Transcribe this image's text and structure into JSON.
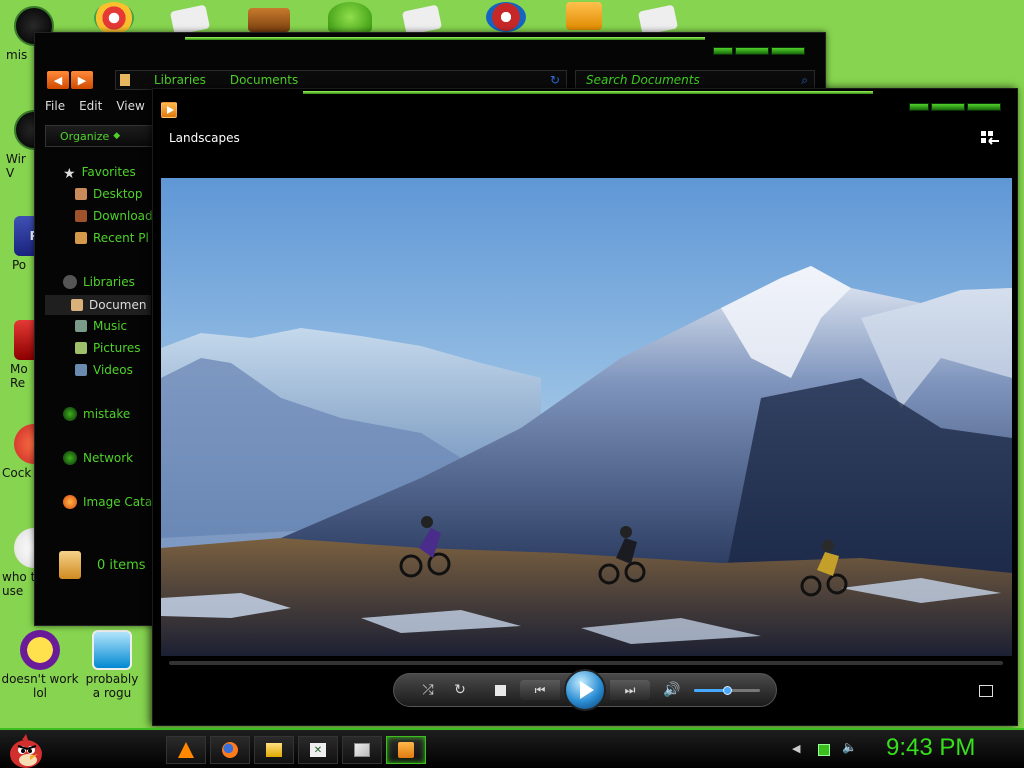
{
  "desktop": {
    "icons": [
      {
        "label": "mis",
        "name": "desktop-icon-mistake"
      },
      {
        "label": "Wir\nV",
        "name": "desktop-icon-windows"
      },
      {
        "label": "Po",
        "name": "desktop-icon-powerpoint"
      },
      {
        "label": "Mo\nRe",
        "name": "desktop-icon-media-reader"
      },
      {
        "label": "Cock",
        "name": "desktop-icon-cock"
      },
      {
        "label": "who t\nuse",
        "name": "desktop-icon-who"
      },
      {
        "label": "doesn't work\nlol",
        "name": "desktop-icon-yahoo-messenger"
      },
      {
        "label": "probably\na rogu",
        "name": "desktop-icon-rogue"
      }
    ]
  },
  "explorer": {
    "breadcrumb": [
      "Libraries",
      "Documents"
    ],
    "search_placeholder": "Search Documents",
    "menu": [
      "File",
      "Edit",
      "View"
    ],
    "organize_label": "Organize",
    "nav": {
      "favorites_header": "Favorites",
      "favorites": [
        "Desktop",
        "Download",
        "Recent Pl"
      ],
      "libraries_header": "Libraries",
      "libraries": [
        "Documen",
        "Music",
        "Pictures",
        "Videos"
      ],
      "mistake": "mistake",
      "network": "Network",
      "image_catalog": "Image Cata"
    },
    "status_text": "0 items"
  },
  "player": {
    "title": "Landscapes",
    "volume_level": 0.5
  },
  "taskbar": {
    "clock": "9:43 PM",
    "apps": [
      "vlc",
      "firefox",
      "explorer",
      "excel",
      "paint",
      "media-player"
    ]
  },
  "colors": {
    "accent_green": "#3cbf1e",
    "desktop_bg": "#86d44f",
    "player_blue": "#2b8ed4"
  }
}
